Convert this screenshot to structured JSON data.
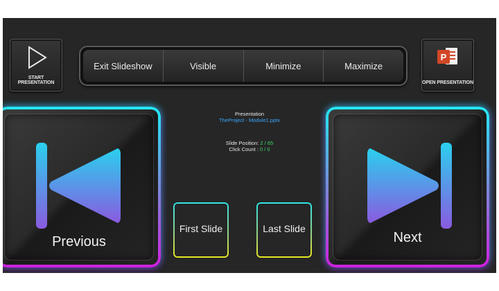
{
  "toolbar": {
    "start_presentation": "START PRESENTATION",
    "open_presentation": "OPEN PRESENTATION",
    "open_icon_letter": "P",
    "segments": [
      "Exit Slideshow",
      "Visible",
      "Minimize",
      "Maximize"
    ]
  },
  "info": {
    "presentation_label": "Presentation",
    "file_name": "TheProject - Module1.pptx",
    "slide_position_label": "Slide Position:",
    "slide_position_value": "2 / 65",
    "click_count_label": "Click Count :",
    "click_count_value": "0 / 0"
  },
  "nav": {
    "previous": "Previous",
    "next": "Next",
    "first_slide": "First Slide",
    "last_slide": "Last Slide"
  },
  "colors": {
    "glow_cyan": "#22e8f5",
    "glow_magenta": "#d020e0",
    "icon_gradient_top": "#2ad0ee",
    "icon_gradient_bottom": "#8a5ae0",
    "info_blue": "#3aa8ff",
    "info_green": "#39d86b",
    "powerpoint_red": "#d24726"
  }
}
